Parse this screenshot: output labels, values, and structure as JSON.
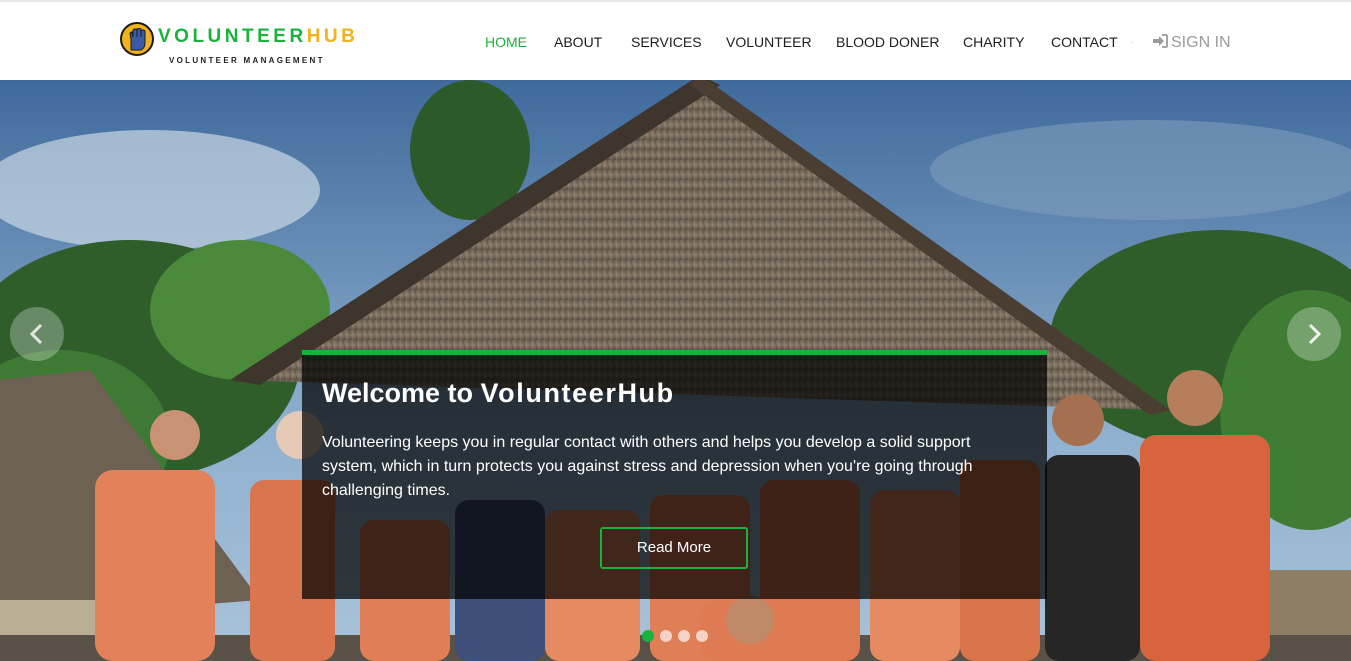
{
  "brand": {
    "name_part1": "VOLUNTEER",
    "name_part2": "HUB",
    "tagline": "VOLUNTEER MANAGEMENT",
    "accent_green": "#19b23b",
    "accent_yellow": "#f2b21d"
  },
  "nav": {
    "items": [
      {
        "label": "HOME",
        "active": true
      },
      {
        "label": "ABOUT",
        "active": false
      },
      {
        "label": "SERVICES",
        "active": false
      },
      {
        "label": "VOLUNTEER",
        "active": false
      },
      {
        "label": "BLOOD DONER",
        "active": false
      },
      {
        "label": "CHARITY",
        "active": false
      },
      {
        "label": "CONTACT",
        "active": false
      }
    ],
    "signin_label": "SIGN IN",
    "signin_icon": "sign-in-icon"
  },
  "hero": {
    "title_prefix": "Welcome to ",
    "title_brand": "VolunteerHub",
    "text": "Volunteering keeps you in regular contact with others and helps you develop a solid support system, which in turn protects you against stress and depression when you're going through challenging times.",
    "button_label": "Read More",
    "prev_icon": "chevron-left-icon",
    "next_icon": "chevron-right-icon",
    "slide_count": 4,
    "active_slide": 1
  }
}
